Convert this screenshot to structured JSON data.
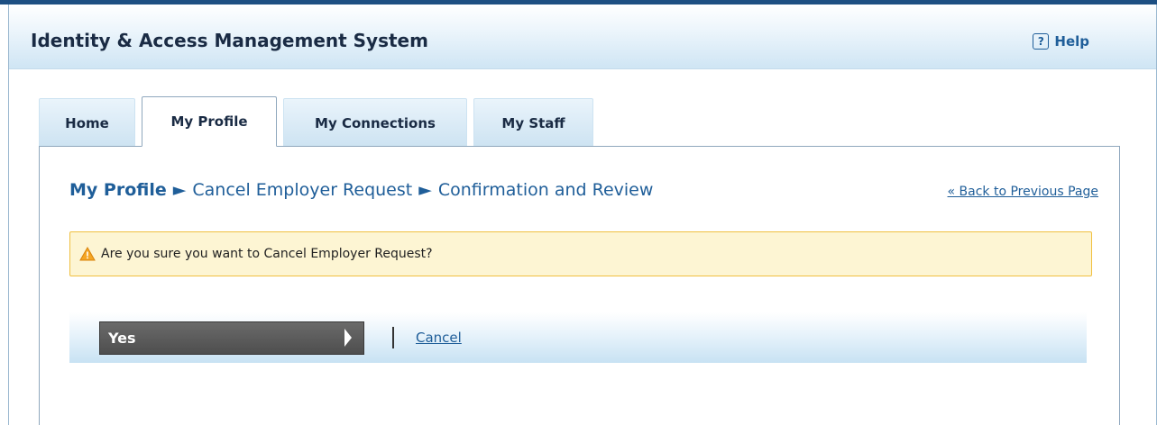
{
  "app": {
    "title": "Identity & Access Management System"
  },
  "header": {
    "help_label": "Help",
    "help_icon": "question-mark-icon"
  },
  "tabs": [
    {
      "label": "Home",
      "active": false
    },
    {
      "label": "My Profile",
      "active": true
    },
    {
      "label": "My Connections",
      "active": false
    },
    {
      "label": "My Staff",
      "active": false
    }
  ],
  "breadcrumb": {
    "root": "My Profile",
    "separator": "►",
    "items": [
      "Cancel Employer Request",
      "Confirmation and Review"
    ]
  },
  "back_link": "« Back to Previous Page",
  "alert": {
    "icon": "warning-icon",
    "message": "Are you sure you want to Cancel Employer Request?"
  },
  "actions": {
    "yes_label": "Yes",
    "cancel_label": "Cancel"
  },
  "colors": {
    "link": "#1f5e99",
    "alert_bg": "#fdf5d3",
    "alert_border": "#f0c040",
    "yes_button": "#555555",
    "top_bar": "#1d4f82"
  }
}
